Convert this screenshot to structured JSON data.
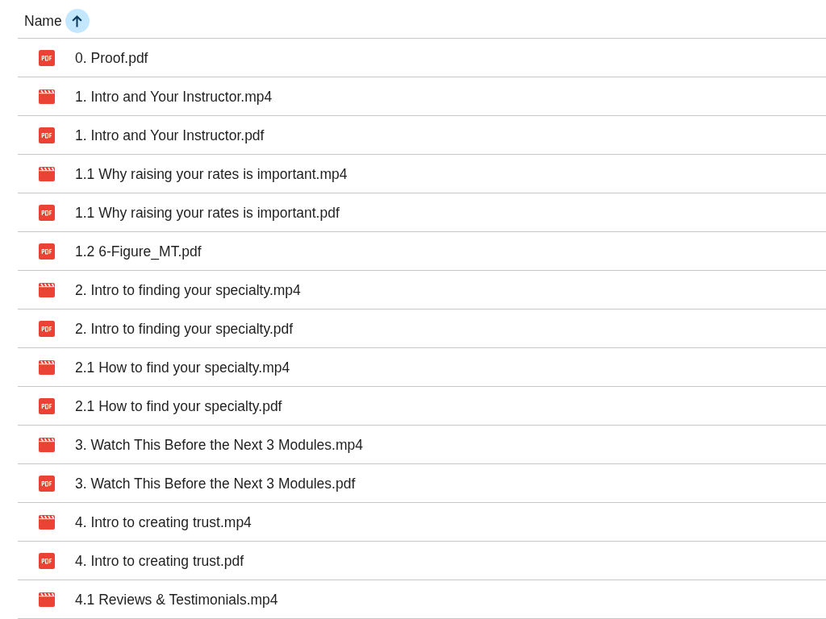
{
  "file_list": {
    "column_header": {
      "label": "Name",
      "sort_ascending": true
    },
    "files": [
      {
        "name": "0. Proof.pdf",
        "kind": "pdf"
      },
      {
        "name": "1. Intro and Your Instructor.mp4",
        "kind": "video"
      },
      {
        "name": "1. Intro and Your Instructor.pdf",
        "kind": "pdf"
      },
      {
        "name": "1.1 Why raising your rates is important.mp4",
        "kind": "video"
      },
      {
        "name": "1.1 Why raising your rates is important.pdf",
        "kind": "pdf"
      },
      {
        "name": "1.2 6-Figure_MT.pdf",
        "kind": "pdf"
      },
      {
        "name": "2. Intro to finding your specialty.mp4",
        "kind": "video"
      },
      {
        "name": "2. Intro to finding your specialty.pdf",
        "kind": "pdf"
      },
      {
        "name": "2.1 How to find your specialty.mp4",
        "kind": "video"
      },
      {
        "name": "2.1 How to find your specialty.pdf",
        "kind": "pdf"
      },
      {
        "name": "3. Watch This Before the Next 3 Modules.mp4",
        "kind": "video"
      },
      {
        "name": "3. Watch This Before the Next 3 Modules.pdf",
        "kind": "pdf"
      },
      {
        "name": "4. Intro to creating trust.mp4",
        "kind": "video"
      },
      {
        "name": "4. Intro to creating trust.pdf",
        "kind": "pdf"
      },
      {
        "name": "4.1 Reviews & Testimonials.mp4",
        "kind": "video"
      }
    ]
  }
}
